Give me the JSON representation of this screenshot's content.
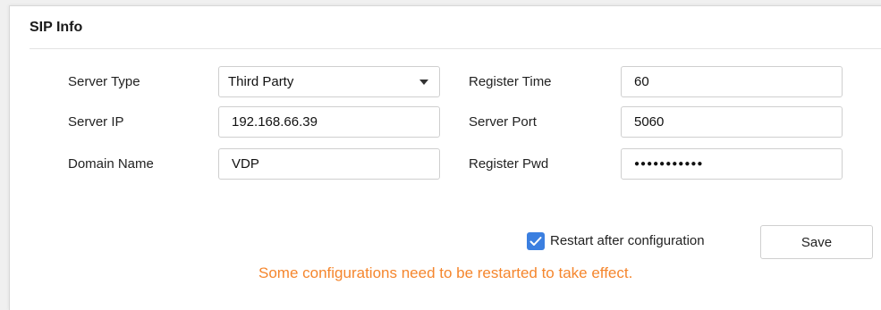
{
  "section": {
    "title": "SIP Info"
  },
  "form": {
    "server_type": {
      "label": "Server Type",
      "value": "Third Party"
    },
    "server_ip": {
      "label": "Server IP",
      "value": "192.168.66.39"
    },
    "domain_name": {
      "label": "Domain Name",
      "value": "VDP"
    },
    "register_time": {
      "label": "Register Time",
      "value": "60"
    },
    "server_port": {
      "label": "Server Port",
      "value": "5060"
    },
    "register_pwd": {
      "label": "Register Pwd",
      "value": "●●●●●●●●●●●"
    }
  },
  "actions": {
    "restart_checkbox": {
      "label": "Restart after configuration",
      "checked": true
    },
    "save_label": "Save"
  },
  "notice": "Some configurations need to be restarted to take effect.",
  "colors": {
    "accent": "#3b7fe0",
    "notice": "#f5862d"
  },
  "icons": {
    "checkbox": "checkmark-icon",
    "dropdown": "chevron-down-icon"
  }
}
